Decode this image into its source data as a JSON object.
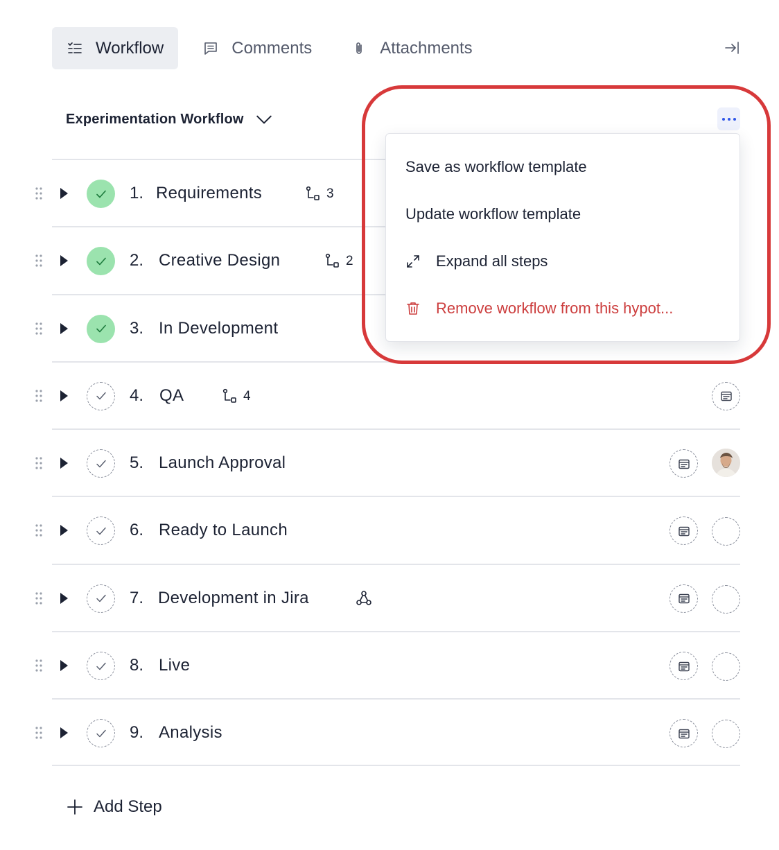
{
  "tabs": [
    {
      "label": "Workflow",
      "icon": "checklist-icon",
      "active": true
    },
    {
      "label": "Comments",
      "icon": "comment-icon",
      "active": false
    },
    {
      "label": "Attachments",
      "icon": "paperclip-icon",
      "active": false
    }
  ],
  "header": {
    "workflow_name": "Experimentation Workflow",
    "more_icon": "ellipsis-icon"
  },
  "steps": [
    {
      "number": "1.",
      "name": "Requirements",
      "completed": true,
      "subtasks": "3"
    },
    {
      "number": "2.",
      "name": "Creative Design",
      "completed": true,
      "subtasks": "2"
    },
    {
      "number": "3.",
      "name": "In Development",
      "completed": true
    },
    {
      "number": "4.",
      "name": "QA",
      "completed": false,
      "subtasks": "4"
    },
    {
      "number": "5.",
      "name": "Launch Approval",
      "completed": false,
      "assignee": "user-avatar"
    },
    {
      "number": "6.",
      "name": "Ready to Launch",
      "completed": false
    },
    {
      "number": "7.",
      "name": "Development in Jira",
      "completed": false,
      "integration": "webhook-icon"
    },
    {
      "number": "8.",
      "name": "Live",
      "completed": false
    },
    {
      "number": "9.",
      "name": "Analysis",
      "completed": false
    }
  ],
  "add_step_label": "Add Step",
  "menu": {
    "items": [
      {
        "label": "Save as workflow template"
      },
      {
        "label": "Update workflow template"
      },
      {
        "label": "Expand all steps",
        "icon": "expand-arrows-icon"
      },
      {
        "label": "Remove workflow from this hypot...",
        "icon": "trash-icon",
        "danger": true
      }
    ]
  },
  "colors": {
    "completed": "#9be3ae",
    "danger": "#cc3d3d",
    "accent": "#2e55e8",
    "highlight": "#d7393a"
  }
}
